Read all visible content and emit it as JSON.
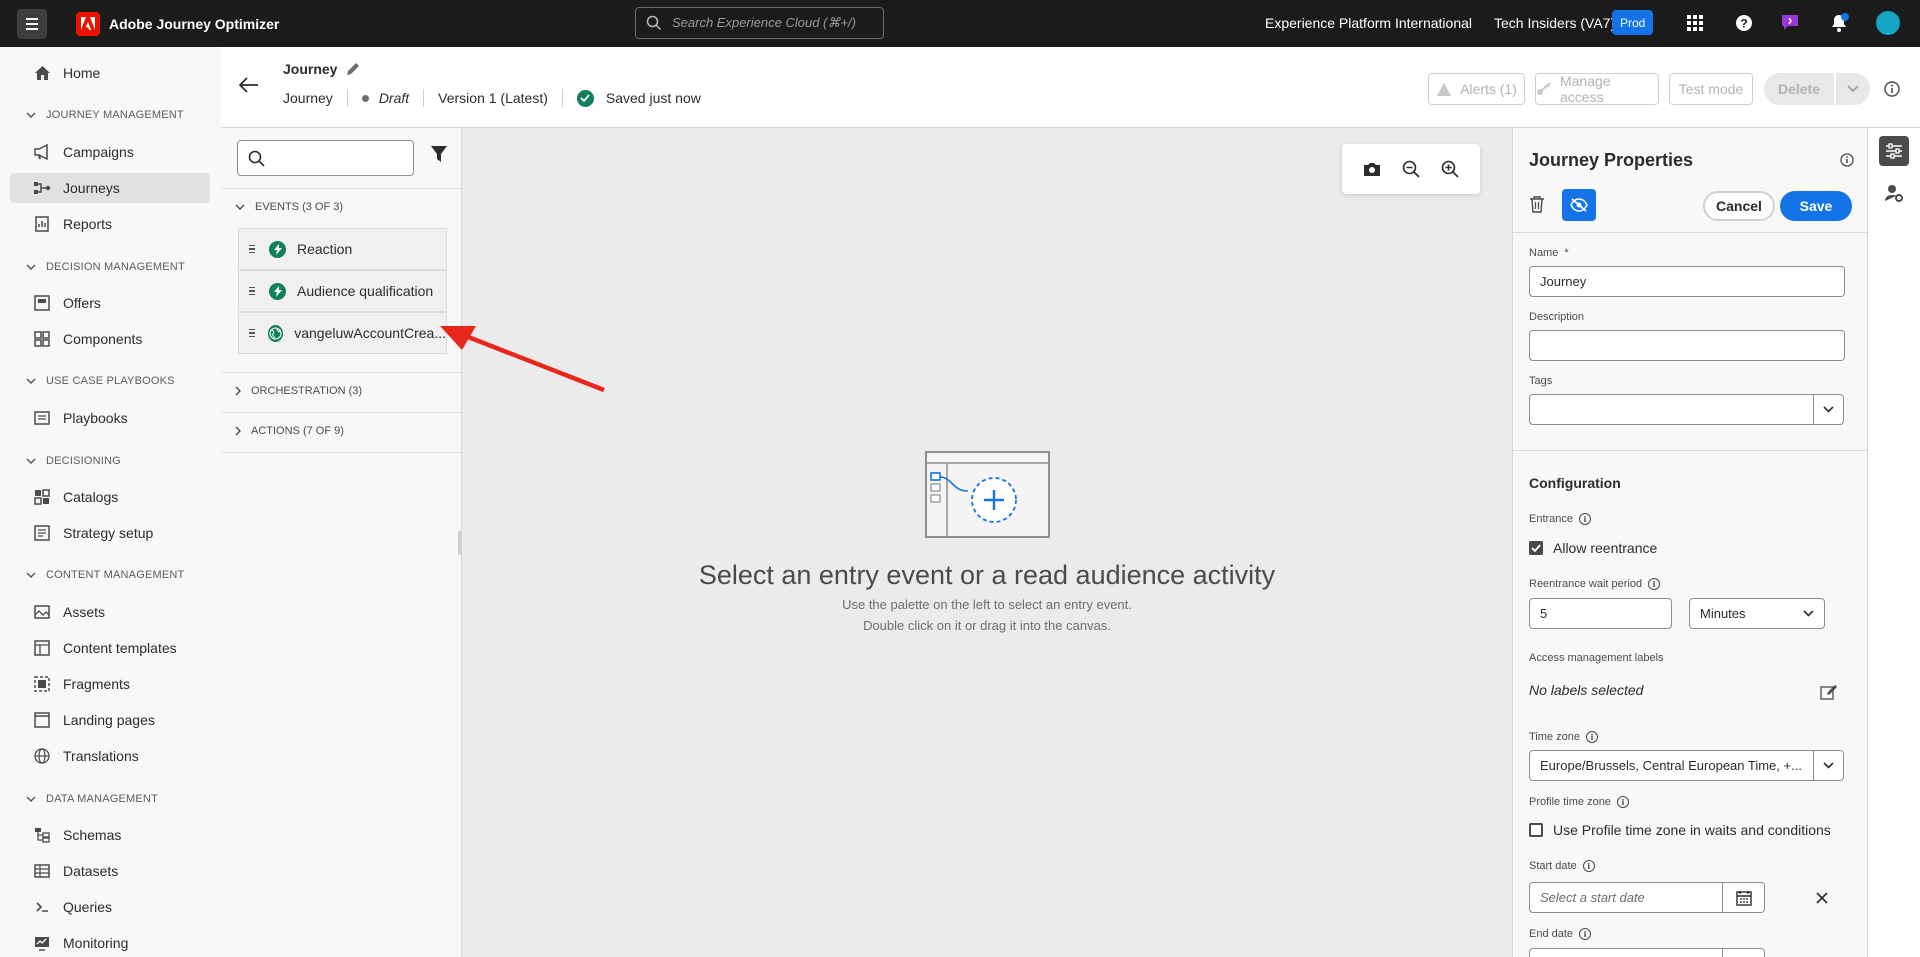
{
  "app": {
    "title": "Adobe Journey Optimizer"
  },
  "topbar": {
    "search_placeholder": "Search Experience Cloud (⌘+/)",
    "org": "Experience Platform International",
    "sandbox": "Tech Insiders (VA7)",
    "env_badge": "Prod"
  },
  "nav": {
    "home": "Home",
    "sections": {
      "journey_management": "JOURNEY MANAGEMENT",
      "decision_management": "DECISION MANAGEMENT",
      "use_case_playbooks": "USE CASE PLAYBOOKS",
      "decisioning": "DECISIONING",
      "content_management": "CONTENT MANAGEMENT",
      "data_management": "DATA MANAGEMENT"
    },
    "items": {
      "campaigns": "Campaigns",
      "journeys": "Journeys",
      "reports": "Reports",
      "offers": "Offers",
      "components": "Components",
      "playbooks": "Playbooks",
      "catalogs": "Catalogs",
      "strategy_setup": "Strategy setup",
      "assets": "Assets",
      "content_templates": "Content templates",
      "fragments": "Fragments",
      "landing_pages": "Landing pages",
      "translations": "Translations",
      "schemas": "Schemas",
      "datasets": "Datasets",
      "queries": "Queries",
      "monitoring": "Monitoring"
    }
  },
  "header": {
    "journey_name": "Journey",
    "type": "Journey",
    "status": "Draft",
    "version": "Version 1 (Latest)",
    "saved": "Saved just now",
    "alerts": "Alerts (1)",
    "manage_access": "Manage access",
    "test_mode": "Test mode",
    "delete": "Delete"
  },
  "palette": {
    "events_section": "EVENTS (3 OF 3)",
    "events": [
      "Reaction",
      "Audience qualification",
      "vangeluwAccountCrea..."
    ],
    "orchestration_section": "ORCHESTRATION (3)",
    "actions_section": "ACTIONS (7 OF 9)"
  },
  "canvas": {
    "title": "Select an entry event or a read audience activity",
    "line1": "Use the palette on the left to select an entry event.",
    "line2": "Double click on it or drag it into the canvas."
  },
  "props": {
    "title": "Journey Properties",
    "cancel": "Cancel",
    "save": "Save",
    "name_label": "Name",
    "name_required": "*",
    "name_value": "Journey",
    "description_label": "Description",
    "description_value": "",
    "tags_label": "Tags",
    "configuration": "Configuration",
    "entrance_label": "Entrance",
    "allow_reentrance": "Allow reentrance",
    "allow_reentrance_checked": true,
    "reentrance_wait_label": "Reentrance wait period",
    "reentrance_wait_value": "5",
    "reentrance_wait_unit": "Minutes",
    "access_labels": "Access management labels",
    "no_labels": "No labels selected",
    "timezone_label": "Time zone",
    "timezone_value": "Europe/Brussels, Central European Time, +...",
    "profile_tz_label": "Profile time zone",
    "profile_tz_option": "Use Profile time zone in waits and conditions",
    "profile_tz_checked": false,
    "start_date_label": "Start date",
    "start_date_placeholder": "Select a start date",
    "end_date_label": "End date"
  },
  "colors": {
    "accent": "#1473e6",
    "event_green": "#12805c",
    "topbar": "#1b1b1b",
    "annotation_red": "#e8261c"
  }
}
